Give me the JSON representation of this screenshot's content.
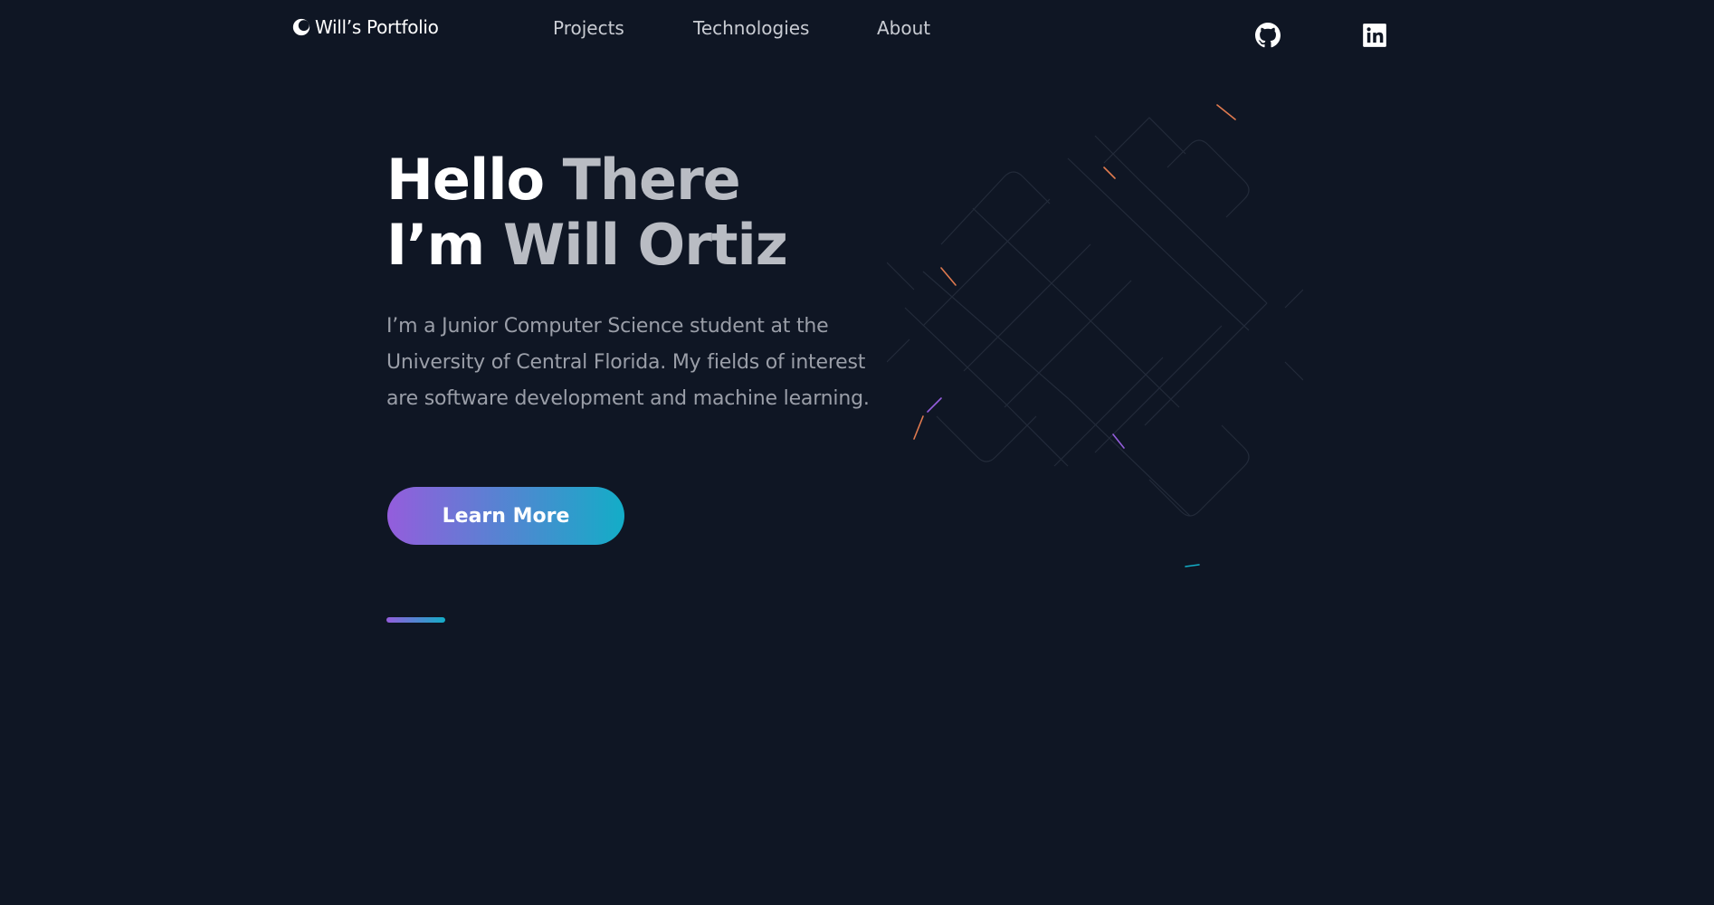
{
  "header": {
    "logo_text": "Will’s Portfolio",
    "logo_icon": "portfolio-logo-icon",
    "nav": [
      {
        "label": "Projects"
      },
      {
        "label": "Technologies"
      },
      {
        "label": "About"
      }
    ],
    "social": [
      {
        "icon": "github-icon"
      },
      {
        "icon": "linkedin-icon"
      }
    ]
  },
  "hero": {
    "title_line1_white": "Hello ",
    "title_line1_grey": "There",
    "title_line2_white": "I’m ",
    "title_line2_grey": "Will Ortiz",
    "description": "I’m a Junior Computer Science student at the University of Central Florida. My fields of interest are software development and machine learning.",
    "cta_label": "Learn More"
  },
  "colors": {
    "background": "#0f1624",
    "gradient_start": "#945ddc",
    "gradient_end": "#13adc7",
    "heading_white": "#ffffff",
    "heading_grey": "#b9bcc3",
    "body_text": "#9a9ea8"
  }
}
